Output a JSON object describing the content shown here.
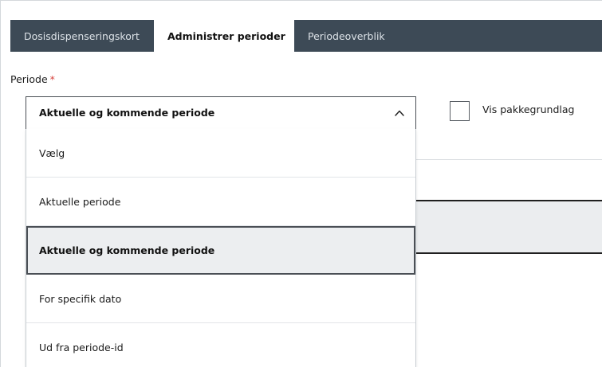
{
  "tabs": [
    {
      "label": "Dosisdispenseringskort",
      "active": false
    },
    {
      "label": "Administrer perioder",
      "active": true
    },
    {
      "label": "Periodeoverblik",
      "active": false
    }
  ],
  "periode_field": {
    "label": "Periode",
    "required_marker": "*",
    "selected_value": "Aktuelle og kommende periode",
    "expanded": true,
    "options": [
      {
        "label": "Vælg",
        "selected": false
      },
      {
        "label": "Aktuelle periode",
        "selected": false
      },
      {
        "label": "Aktuelle og kommende periode",
        "selected": true
      },
      {
        "label": "For specifik dato",
        "selected": false
      },
      {
        "label": "Ud fra periode-id",
        "selected": false
      }
    ]
  },
  "checkbox": {
    "label": "Vis pakkegrundlag",
    "checked": false
  },
  "icons": {
    "dropdown_toggle": "chevron-up-icon"
  },
  "colors": {
    "tab_bar": "#3d4a56",
    "required_star": "#d6423c",
    "selected_option_bg": "#eceef0",
    "border_dark": "#4a4f55"
  }
}
